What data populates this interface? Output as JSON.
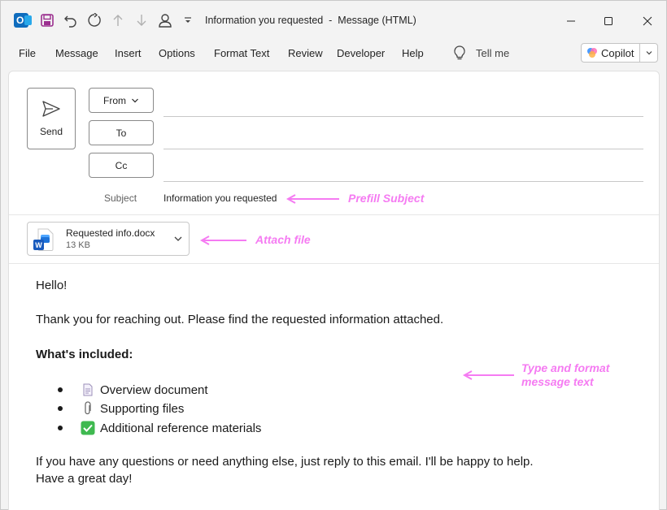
{
  "window": {
    "title": "Information you requested  -  Message (HTML)"
  },
  "menu": {
    "items": [
      "File",
      "Message",
      "Insert",
      "Options",
      "Format Text",
      "Review",
      "Developer",
      "Help"
    ],
    "tell_me": "Tell me",
    "copilot": "Copilot"
  },
  "compose": {
    "send_label": "Send",
    "from_label": "From",
    "to_label": "To",
    "cc_label": "Cc",
    "subject_label": "Subject",
    "subject_value": "Information you requested"
  },
  "attachment": {
    "name": "Requested info.docx",
    "size": "13 KB"
  },
  "annotations": {
    "prefill": "Prefill Subject",
    "attach": "Attach file",
    "type_line1": "Type and format",
    "type_line2": "message text",
    "color": "#f57bf2"
  },
  "body": {
    "greeting": "Hello!",
    "intro": "Thank you for reaching out. Please find the requested information attached.",
    "included_heading": "What's included:",
    "items": [
      {
        "icon": "page-icon",
        "text": "Overview document"
      },
      {
        "icon": "paperclip-icon",
        "text": "Supporting files"
      },
      {
        "icon": "checkmark-icon",
        "text": "Additional reference materials"
      }
    ],
    "closing1": "If you have any questions or need anything else, just reply to this email. I'll be happy to help.",
    "closing2": "Have a great day!"
  }
}
